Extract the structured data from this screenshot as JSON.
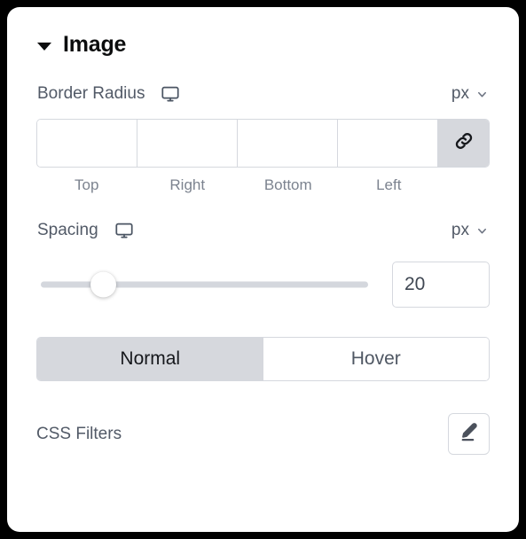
{
  "panel": {
    "section": {
      "title": "Image",
      "expanded": true,
      "caret_icon": "caret-down-icon"
    },
    "border_radius": {
      "label": "Border Radius",
      "device_icon": "desktop-monitor-icon",
      "unit": "px",
      "unit_chevron_icon": "chevron-down-icon",
      "link_icon": "link-chain-icon",
      "link_active": true,
      "fields": [
        {
          "name": "top",
          "label": "Top",
          "value": "",
          "placeholder": ""
        },
        {
          "name": "right",
          "label": "Right",
          "value": "",
          "placeholder": ""
        },
        {
          "name": "bottom",
          "label": "Bottom",
          "value": "",
          "placeholder": ""
        },
        {
          "name": "left",
          "label": "Left",
          "value": "",
          "placeholder": ""
        }
      ]
    },
    "spacing": {
      "label": "Spacing",
      "device_icon": "desktop-monitor-icon",
      "unit": "px",
      "unit_chevron_icon": "chevron-down-icon",
      "value": "20",
      "slider_percent": 20
    },
    "state_toggle": {
      "options": [
        {
          "label": "Normal",
          "active": true
        },
        {
          "label": "Hover",
          "active": false
        }
      ]
    },
    "css_filters": {
      "label": "CSS Filters",
      "edit_icon": "pencil-edit-icon"
    }
  },
  "colors": {
    "background": "#000000",
    "panel": "#ffffff",
    "border": "#d5d8de",
    "active_fill": "#d6d8dd",
    "label_text": "#525a67",
    "muted_text": "#7c838f",
    "title_text": "#0c0d0e"
  }
}
